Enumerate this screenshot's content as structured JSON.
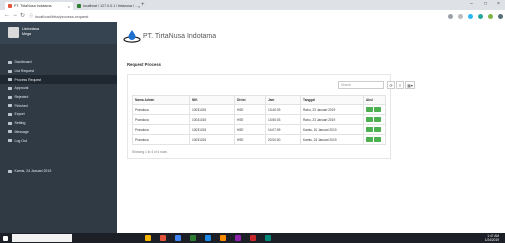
{
  "browser": {
    "tabs": [
      {
        "title": "PT. TirtaNusa Indotama"
      },
      {
        "title": "localhost / 127.0.0.1 / tirtanusa / ..."
      }
    ],
    "url": "localhost/tirta/process-request"
  },
  "sidebar": {
    "user": {
      "name": "Lisbonissa",
      "role": "Mega"
    },
    "items": [
      {
        "label": "Dashboard",
        "icon": "dashboard-icon",
        "active": false
      },
      {
        "label": "List Request",
        "icon": "list-icon",
        "active": false
      },
      {
        "label": "Process Request",
        "icon": "list-icon",
        "active": true
      },
      {
        "label": "Approval",
        "icon": "check-icon",
        "active": false
      },
      {
        "label": "Rejected",
        "icon": "reject-icon",
        "active": false
      },
      {
        "label": "Finished",
        "icon": "finished-icon",
        "active": false
      },
      {
        "label": "Export",
        "icon": "export-icon",
        "active": false
      },
      {
        "label": "Setting",
        "icon": "gear-icon",
        "active": false
      },
      {
        "label": "Message",
        "icon": "user-icon",
        "active": false
      },
      {
        "label": "Log Out",
        "icon": "logout-icon",
        "active": false
      }
    ],
    "date": "Kamis, 24 Januari 2019"
  },
  "brand": {
    "name": "PT. TirtaNusa Indotama"
  },
  "page": {
    "title": "Request Process"
  },
  "table": {
    "search_placeholder": "Search",
    "columns": [
      "Nama Admin",
      "NIK",
      "Divisi",
      "Jam",
      "Tanggal",
      "Aksi"
    ],
    "rows": [
      [
        "Prandoca",
        "10031015",
        "HSE",
        "13:40:03",
        "Rabu, 23 Januari 2019"
      ],
      [
        "Prandoca",
        "10031015",
        "HSE",
        "13:50:03",
        "Rabu, 23 Januari 2019"
      ],
      [
        "Prandoca",
        "10031015",
        "HSE",
        "14:07:09",
        "Kamis, 10 Januari 2019"
      ],
      [
        "Prandoca",
        "10031015",
        "HSE",
        "20:00:00",
        "Kamis, 24 Januari 2019"
      ]
    ],
    "showing": "Showing 1 to 4 of 4 rows"
  },
  "taskbar": {
    "time": "1:47 AM",
    "date": "1/24/2019"
  },
  "colors": {
    "sidebar": "#2f3a45",
    "action_green": "#4caf50"
  }
}
